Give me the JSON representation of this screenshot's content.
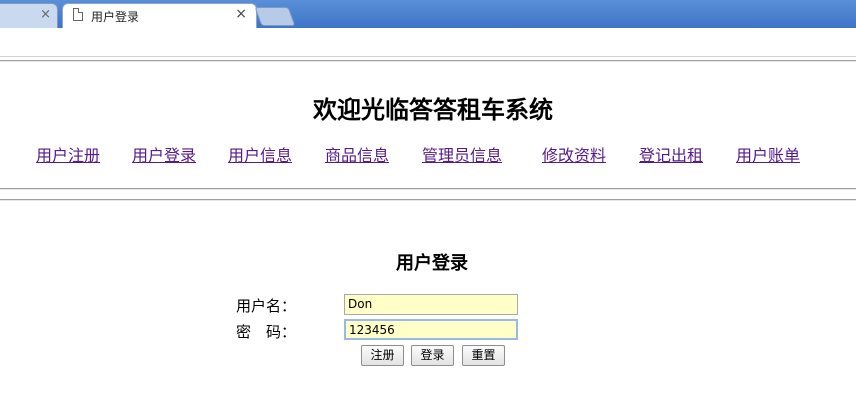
{
  "browser": {
    "tabs": [
      {
        "label": "",
        "close": "×"
      },
      {
        "label": "用户登录",
        "close": "×"
      }
    ]
  },
  "site": {
    "title": "欢迎光临答答租车系统",
    "nav": [
      "用户注册",
      "用户登录",
      "用户信息",
      "商品信息",
      "管理员信息",
      "修改资料",
      "登记出租",
      "用户账单"
    ]
  },
  "login": {
    "heading": "用户登录",
    "username_label": "用户名：",
    "username_value": "Don",
    "password_label": "密　码：",
    "password_value": "123456",
    "buttons": {
      "register": "注册",
      "login": "登录",
      "reset": "重置"
    }
  }
}
